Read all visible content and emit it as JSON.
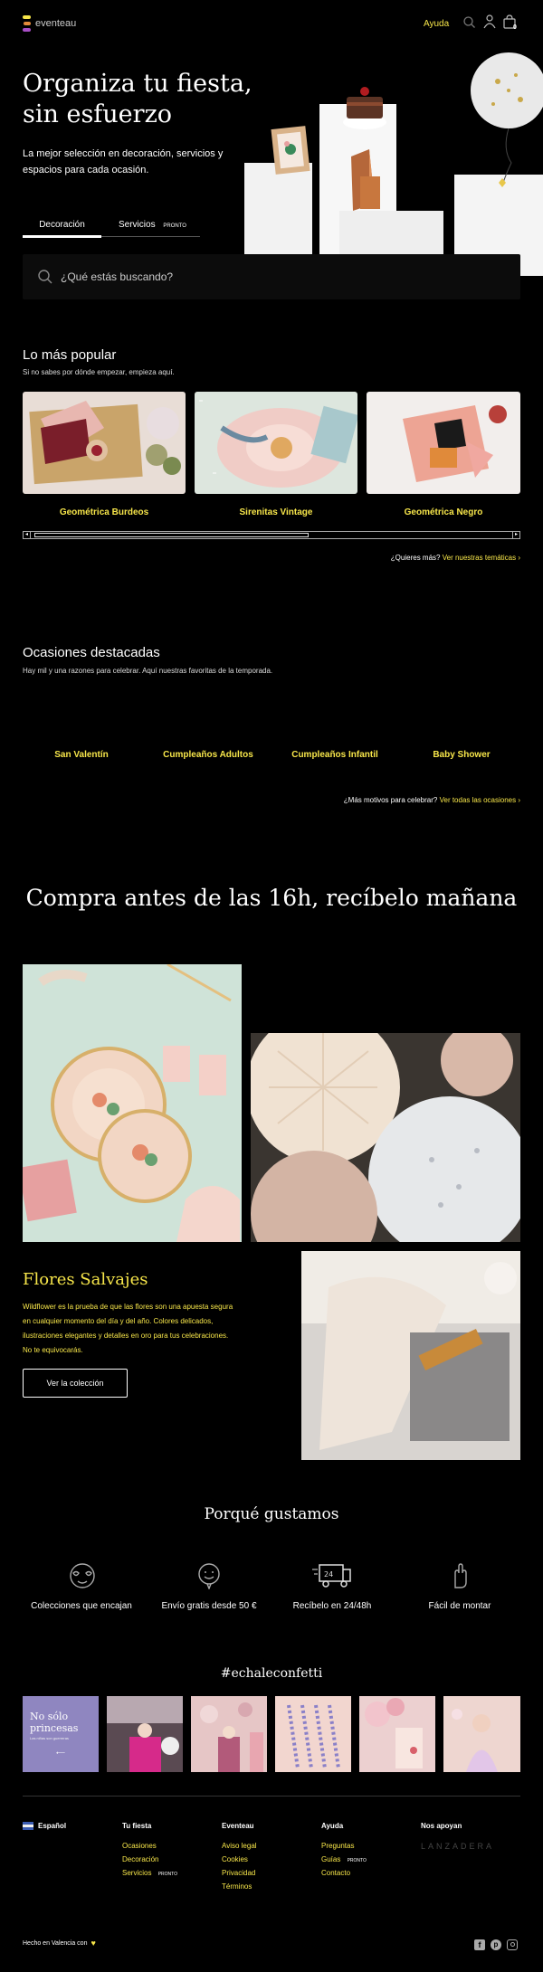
{
  "header": {
    "brand": "eventeau",
    "help": "Ayuda",
    "cart_count": "0"
  },
  "hero": {
    "title_line1": "Organiza tu fiesta,",
    "title_line2": "sin esfuerzo",
    "subtitle_line1": "La mejor selección en decoración, servicios y",
    "subtitle_line2": "espacios para cada ocasión.",
    "tabs": [
      {
        "label": "Decoración"
      },
      {
        "label": "Servicios",
        "badge": "PRONTO"
      }
    ],
    "search_placeholder": "¿Qué estás buscando?"
  },
  "popular": {
    "title": "Lo más popular",
    "subtitle": "Si no sabes por dónde empezar, empieza aquí.",
    "items": [
      {
        "label": "Geométrica Burdeos"
      },
      {
        "label": "Sirenitas Vintage"
      },
      {
        "label": "Geométrica Negro"
      }
    ],
    "more_prefix": "¿Quieres más?",
    "more_link": "Ver nuestras temáticas"
  },
  "occasions": {
    "title": "Ocasiones destacadas",
    "subtitle": "Hay mil y una razones para celebrar. Aquí nuestras favoritas de la temporada.",
    "items": [
      "San Valentín",
      "Cumpleaños Adultos",
      "Cumpleaños Infantil",
      "Baby Shower"
    ],
    "more_prefix": "¿Más motivos para celebrar?",
    "more_link": "Ver todas las ocasiones"
  },
  "shipping_banner": "Compra antes de las 16h, recíbelo mañana",
  "collection": {
    "title": "Flores Salvajes",
    "desc_lines": [
      "Wildflower es la prueba de que las flores son una apuesta segura",
      "en cualquier momento del día y del año. Colores delicados,",
      "ilustraciones elegantes y detalles en oro para tus celebraciones.",
      "No te equivocarás."
    ],
    "button": "Ver la colección"
  },
  "why": {
    "title": "Porqué gustamos",
    "items": [
      {
        "label": "Colecciones que encajan",
        "icon": "hearts-glasses-icon"
      },
      {
        "label": "Envío gratis desde 50 €",
        "icon": "smile-tag-icon"
      },
      {
        "label": "Recíbelo en 24/48h",
        "icon": "truck-icon"
      },
      {
        "label": "Fácil de montar",
        "icon": "hand-icon"
      }
    ]
  },
  "social": {
    "hashtag": "#echaleconfetti",
    "first_tile_line1": "No sólo",
    "first_tile_line2": "princesas",
    "first_tile_small": "Las niñas son guerreras"
  },
  "footer": {
    "language": "Español",
    "cols": [
      {
        "title": "Tu fiesta",
        "links": [
          {
            "label": "Ocasiones"
          },
          {
            "label": "Decoración"
          },
          {
            "label": "Servicios",
            "badge": "PRONTO"
          }
        ]
      },
      {
        "title": "Eventeau",
        "links": [
          {
            "label": "Aviso legal"
          },
          {
            "label": "Cookies"
          },
          {
            "label": "Privacidad"
          },
          {
            "label": "Términos"
          }
        ]
      },
      {
        "title": "Ayuda",
        "links": [
          {
            "label": "Preguntas"
          },
          {
            "label": "Guías",
            "badge": "PRONTO"
          },
          {
            "label": "Contacto"
          }
        ]
      }
    ],
    "support_title": "Nos apoyan",
    "support_logo": "LANZADERA",
    "made_in": "Hecho en Valencia con"
  },
  "colors": {
    "accent": "#f7e64a",
    "bg": "#000000",
    "search_bg": "#111111",
    "lilac": "#8f86c0"
  }
}
